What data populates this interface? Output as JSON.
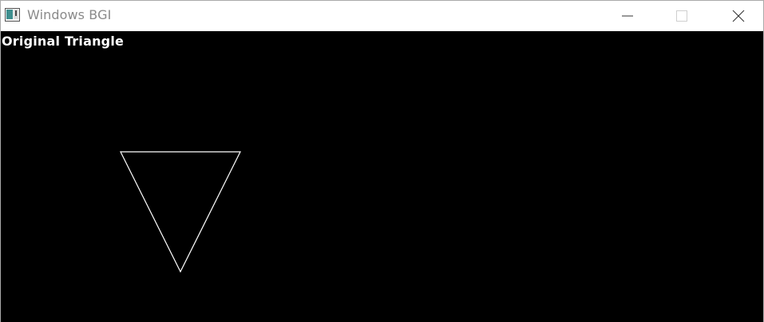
{
  "window": {
    "title": "Windows BGI",
    "controls": {
      "minimize_icon": "minimize-icon",
      "maximize_icon": "maximize-icon",
      "close_icon": "close-icon"
    }
  },
  "canvas": {
    "background": "#000000",
    "caption": "Original Triangle",
    "line_color": "#ffffff"
  }
}
